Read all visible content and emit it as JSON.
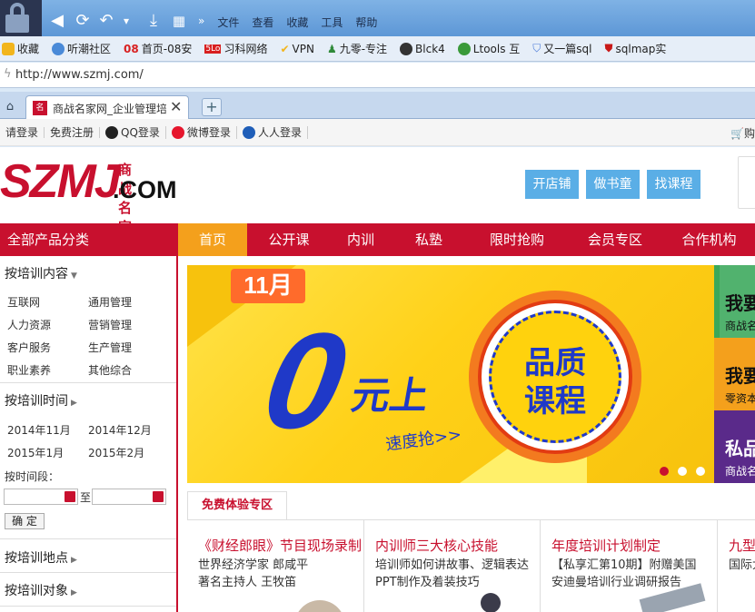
{
  "browser": {
    "title_text": "",
    "menu": [
      "文件",
      "查看",
      "收藏",
      "工具",
      "帮助"
    ],
    "bookmarks": [
      {
        "label": "收藏",
        "color": "#f2b51c"
      },
      {
        "label": "听潮社区",
        "color": "#4a8ad8"
      },
      {
        "label": "首页-08安",
        "prefix": "08",
        "color": "#d82020"
      },
      {
        "label": "习科网络",
        "prefix": "5Lo",
        "color": "#d82020"
      },
      {
        "label": "VPN",
        "color": "#f2b51c"
      },
      {
        "label": "九零-专注",
        "color": "#2f8a3a"
      },
      {
        "label": "Blck4",
        "color": "#333333"
      },
      {
        "label": "Ltools 互",
        "color": "#3a9a3a"
      },
      {
        "label": "又一篇sql",
        "color": "#4a7ad8"
      },
      {
        "label": "sqlmap实",
        "color": "#c81818"
      }
    ],
    "url": "http://www.szmj.com/",
    "tab_title": "商战名家网_企业管理培训",
    "new_tab_symbol": "+"
  },
  "site_top": {
    "links": [
      {
        "label": "请登录",
        "icon": ""
      },
      {
        "label": "免费注册",
        "icon": ""
      },
      {
        "label": "QQ登录",
        "icon": "qq-icon"
      },
      {
        "label": "微博登录",
        "icon": "weibo-icon"
      },
      {
        "label": "人人登录",
        "icon": "renren-icon"
      }
    ],
    "cart_label": "购"
  },
  "header": {
    "logo_text": "SZMJ",
    "logo_cn": "商战名家",
    "logo_com": ".COM",
    "buttons": [
      "开店铺",
      "做书童",
      "找课程"
    ]
  },
  "nav": {
    "sidebar_header": "全部产品分类",
    "items": [
      "首页",
      "公开课",
      "内训",
      "私塾",
      "限时抢购",
      "会员专区",
      "合作机构"
    ],
    "active_index": 0
  },
  "sidebar": {
    "content_title": "按培训内容",
    "content_links": [
      "互联网",
      "通用管理",
      "人力资源",
      "营销管理",
      "客户服务",
      "生产管理",
      "职业素养",
      "其他综合"
    ],
    "time_title": "按培训时间",
    "time_links": [
      "2014年11月",
      "2014年12月",
      "2015年1月",
      "2015年2月"
    ],
    "period_label": "按时间段：",
    "to_label": "至",
    "confirm_label": "确 定",
    "location_title": "按培训地点",
    "audience_title": "按培训对象"
  },
  "banner": {
    "month": "11月",
    "zero": "0",
    "yuan_shang": "元上",
    "grab": "速度抢>>",
    "seal_line1": "品质",
    "seal_line2": "课程",
    "slides": 3,
    "active_slide": 0,
    "colors": {
      "bg": "#ffd118",
      "blue": "#1f39c8",
      "orange": "#f37a1f",
      "red": "#c8102e"
    }
  },
  "side_ads": [
    {
      "big": "我要",
      "small": "商战名",
      "color": "#3aa85a"
    },
    {
      "big": "我要",
      "small": "零资本",
      "color": "#f4a01c"
    },
    {
      "big": "私品",
      "small": "商战名",
      "color": "#5a2a8a"
    }
  ],
  "free_trial": {
    "tab_label": "免费体验专区",
    "cards": [
      {
        "title": "《财经郎眼》节目现场录制",
        "line1": "世界经济学家  郎咸平",
        "line2": "著名主持人 王牧笛"
      },
      {
        "title": "内训师三大核心技能",
        "line1": "培训师如何讲故事、逻辑表达",
        "line2": "PPT制作及着装技巧"
      },
      {
        "title": "年度培训计划制定",
        "line1": "【私享汇第10期】附赠美国",
        "line2": "安迪曼培训行业调研报告"
      },
      {
        "title": "九型",
        "line1": "国际大",
        "line2": ""
      }
    ]
  }
}
